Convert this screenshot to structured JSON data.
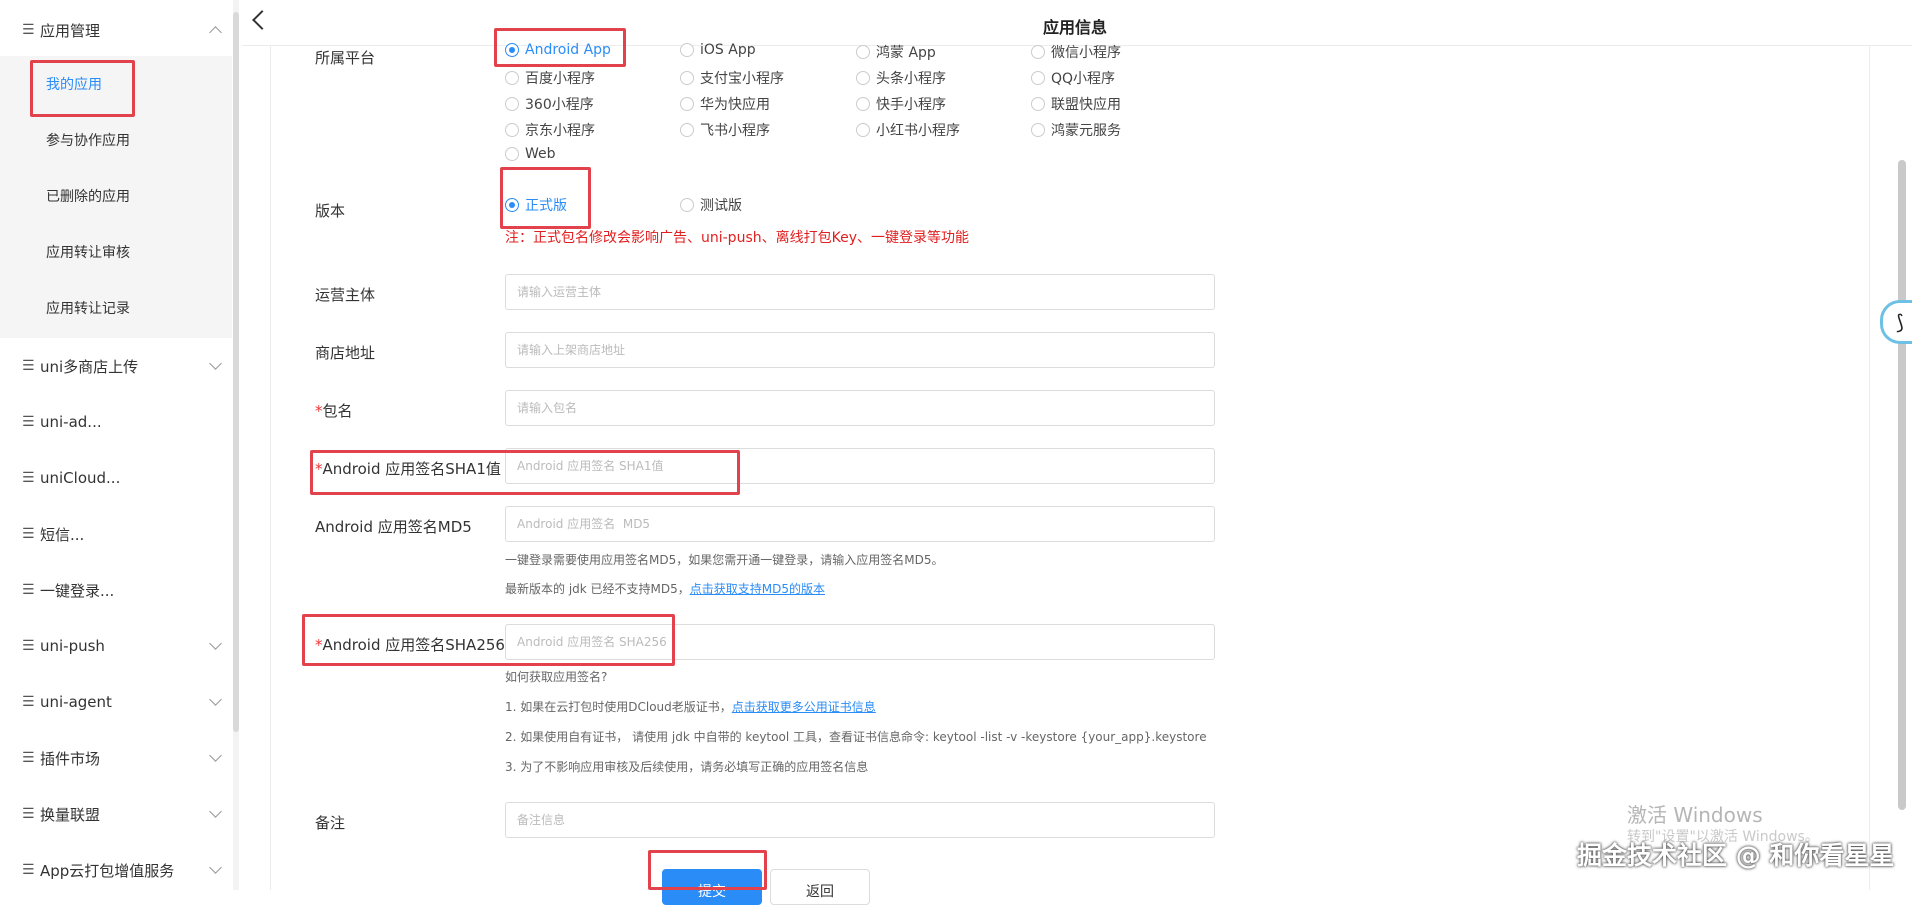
{
  "sidebar": {
    "groups": [
      {
        "label": "应用管理",
        "expanded": true
      },
      {
        "label": "uni多商店上传"
      },
      {
        "label": "uni-ad..."
      },
      {
        "label": "uniCloud..."
      },
      {
        "label": "短信..."
      },
      {
        "label": "一键登录..."
      },
      {
        "label": "uni-push"
      },
      {
        "label": "uni-agent"
      },
      {
        "label": "插件市场"
      },
      {
        "label": "换量联盟"
      },
      {
        "label": "App云打包增值服务"
      }
    ],
    "sub_items": [
      {
        "label": "我的应用",
        "active": true
      },
      {
        "label": "参与协作应用"
      },
      {
        "label": "已删除的应用"
      },
      {
        "label": "应用转让审核"
      },
      {
        "label": "应用转让记录"
      }
    ]
  },
  "header": {
    "title": "应用信息"
  },
  "form": {
    "platform": {
      "label": "所属平台",
      "options": [
        "Android App",
        "iOS App",
        "鸿蒙 App",
        "微信小程序",
        "百度小程序",
        "支付宝小程序",
        "头条小程序",
        "QQ小程序",
        "360小程序",
        "华为快应用",
        "快手小程序",
        "联盟快应用",
        "京东小程序",
        "飞书小程序",
        "小红书小程序",
        "鸿蒙元服务",
        "Web"
      ],
      "selected": "Android App"
    },
    "version": {
      "label": "版本",
      "options": [
        "正式版",
        "测试版"
      ],
      "selected": "正式版",
      "note": "注：正式包名修改会影响广告、uni-push、离线打包Key、一键登录等功能"
    },
    "operator": {
      "label": "运营主体",
      "placeholder": "请输入运营主体",
      "value": ""
    },
    "store": {
      "label": "商店地址",
      "placeholder": "请输入上架商店地址",
      "value": ""
    },
    "package": {
      "required_mark": "*",
      "label": "包名",
      "placeholder": "请输入包名",
      "value": ""
    },
    "sha1": {
      "required_mark": "*",
      "label": "Android 应用签名SHA1值",
      "placeholder": "Android 应用签名 SHA1值",
      "value": ""
    },
    "md5": {
      "label": "Android 应用签名MD5",
      "placeholder": "Android 应用签名  MD5",
      "value": "",
      "hint1": "一键登录需要使用应用签名MD5，如果您需开通一键登录，请输入应用签名MD5。",
      "hint2_prefix": "最新版本的 jdk 已经不支持MD5，",
      "hint2_link": "点击获取支持MD5的版本"
    },
    "sha256": {
      "required_mark": "*",
      "label": "Android 应用签名SHA256",
      "placeholder": "Android 应用签名 SHA256",
      "value": "",
      "help_title": "如何获取应用签名?",
      "help1_prefix": "1. 如果在云打包时使用DCloud老版证书，",
      "help1_link": "点击获取更多公用证书信息",
      "help2": "2. 如果使用自有证书， 请使用 jdk 中自带的 keytool 工具，查看证书信息命令: keytool -list -v -keystore {your_app}.keystore",
      "help3": "3. 为了不影响应用审核及后续使用，请务必填写正确的应用签名信息"
    },
    "remark": {
      "label": "备注",
      "placeholder": "备注信息",
      "value": ""
    }
  },
  "buttons": {
    "submit": "提交",
    "back": "返回"
  },
  "overlay": {
    "windows_line1": "激活 Windows",
    "windows_line2": "转到\"设置\"以激活 Windows。",
    "juejin": "掘金技术社区 @ 和你看星星"
  },
  "colors": {
    "accent": "#2a8cf7",
    "annotation_red": "#e2424b",
    "warning_red": "#e02020"
  }
}
